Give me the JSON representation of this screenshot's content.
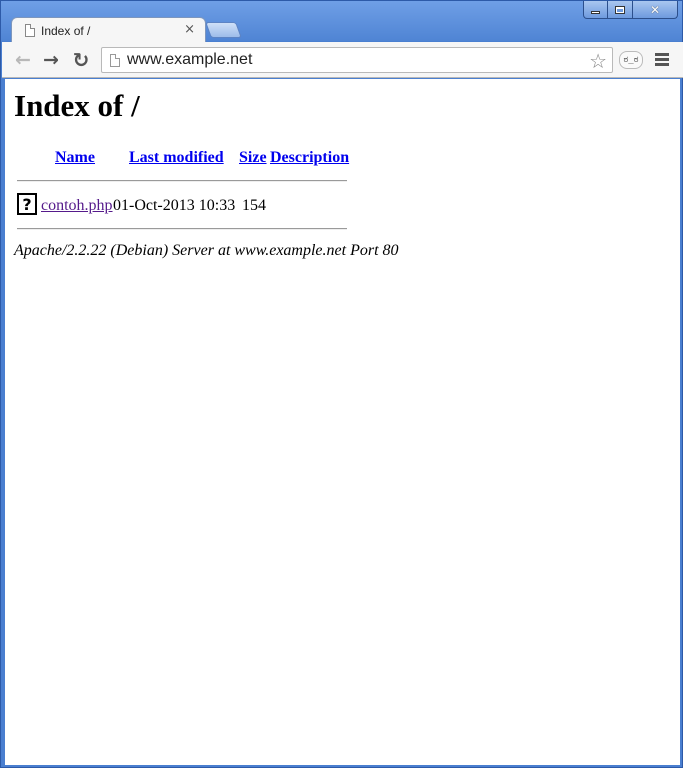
{
  "browser": {
    "tab_title": "Index of /",
    "tab_close_glyph": "×",
    "url": "www.example.net",
    "back_glyph": "←",
    "forward_glyph": "→",
    "reload_glyph": "↻",
    "star_glyph": "☆",
    "extension_label": "ಠ_ಠ",
    "window_controls": {
      "minimize": "",
      "maximize": "",
      "close_glyph": "✕"
    }
  },
  "page": {
    "heading": "Index of /",
    "columns": [
      "Name",
      "Last modified",
      "Size",
      "Description"
    ],
    "files": [
      {
        "name": "contoh.php",
        "last_modified": "01-Oct-2013 10:33",
        "size": "154",
        "description": "",
        "icon": "unknown-file-icon",
        "icon_glyph": "?"
      }
    ],
    "server_signature": "Apache/2.2.22 (Debian) Server at www.example.net Port 80"
  },
  "colors": {
    "link": "#0000ee",
    "visited_link": "#551a8b",
    "window_frame": "#4a7fd0"
  }
}
